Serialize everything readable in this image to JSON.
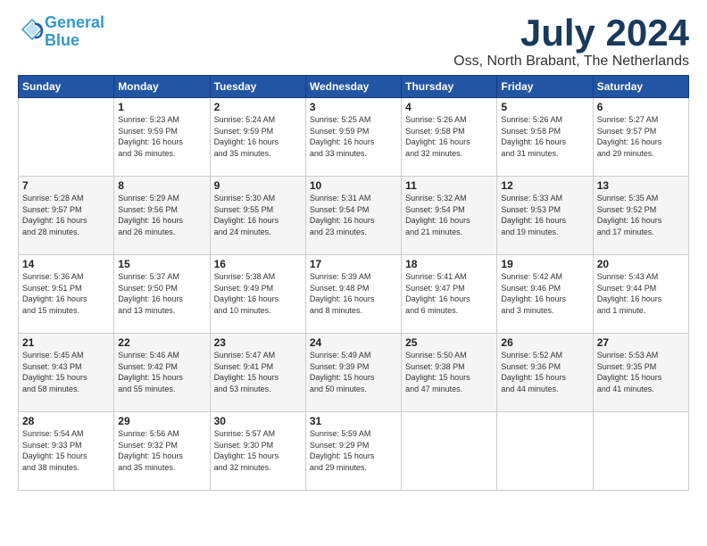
{
  "logo": {
    "line1": "General",
    "line2": "Blue"
  },
  "title": "July 2024",
  "location": "Oss, North Brabant, The Netherlands",
  "days_of_week": [
    "Sunday",
    "Monday",
    "Tuesday",
    "Wednesday",
    "Thursday",
    "Friday",
    "Saturday"
  ],
  "weeks": [
    [
      {
        "day": "",
        "info": ""
      },
      {
        "day": "1",
        "info": "Sunrise: 5:23 AM\nSunset: 9:59 PM\nDaylight: 16 hours\nand 36 minutes."
      },
      {
        "day": "2",
        "info": "Sunrise: 5:24 AM\nSunset: 9:59 PM\nDaylight: 16 hours\nand 35 minutes."
      },
      {
        "day": "3",
        "info": "Sunrise: 5:25 AM\nSunset: 9:59 PM\nDaylight: 16 hours\nand 33 minutes."
      },
      {
        "day": "4",
        "info": "Sunrise: 5:26 AM\nSunset: 9:58 PM\nDaylight: 16 hours\nand 32 minutes."
      },
      {
        "day": "5",
        "info": "Sunrise: 5:26 AM\nSunset: 9:58 PM\nDaylight: 16 hours\nand 31 minutes."
      },
      {
        "day": "6",
        "info": "Sunrise: 5:27 AM\nSunset: 9:57 PM\nDaylight: 16 hours\nand 29 minutes."
      }
    ],
    [
      {
        "day": "7",
        "info": "Sunrise: 5:28 AM\nSunset: 9:57 PM\nDaylight: 16 hours\nand 28 minutes."
      },
      {
        "day": "8",
        "info": "Sunrise: 5:29 AM\nSunset: 9:56 PM\nDaylight: 16 hours\nand 26 minutes."
      },
      {
        "day": "9",
        "info": "Sunrise: 5:30 AM\nSunset: 9:55 PM\nDaylight: 16 hours\nand 24 minutes."
      },
      {
        "day": "10",
        "info": "Sunrise: 5:31 AM\nSunset: 9:54 PM\nDaylight: 16 hours\nand 23 minutes."
      },
      {
        "day": "11",
        "info": "Sunrise: 5:32 AM\nSunset: 9:54 PM\nDaylight: 16 hours\nand 21 minutes."
      },
      {
        "day": "12",
        "info": "Sunrise: 5:33 AM\nSunset: 9:53 PM\nDaylight: 16 hours\nand 19 minutes."
      },
      {
        "day": "13",
        "info": "Sunrise: 5:35 AM\nSunset: 9:52 PM\nDaylight: 16 hours\nand 17 minutes."
      }
    ],
    [
      {
        "day": "14",
        "info": "Sunrise: 5:36 AM\nSunset: 9:51 PM\nDaylight: 16 hours\nand 15 minutes."
      },
      {
        "day": "15",
        "info": "Sunrise: 5:37 AM\nSunset: 9:50 PM\nDaylight: 16 hours\nand 13 minutes."
      },
      {
        "day": "16",
        "info": "Sunrise: 5:38 AM\nSunset: 9:49 PM\nDaylight: 16 hours\nand 10 minutes."
      },
      {
        "day": "17",
        "info": "Sunrise: 5:39 AM\nSunset: 9:48 PM\nDaylight: 16 hours\nand 8 minutes."
      },
      {
        "day": "18",
        "info": "Sunrise: 5:41 AM\nSunset: 9:47 PM\nDaylight: 16 hours\nand 6 minutes."
      },
      {
        "day": "19",
        "info": "Sunrise: 5:42 AM\nSunset: 9:46 PM\nDaylight: 16 hours\nand 3 minutes."
      },
      {
        "day": "20",
        "info": "Sunrise: 5:43 AM\nSunset: 9:44 PM\nDaylight: 16 hours\nand 1 minute."
      }
    ],
    [
      {
        "day": "21",
        "info": "Sunrise: 5:45 AM\nSunset: 9:43 PM\nDaylight: 15 hours\nand 58 minutes."
      },
      {
        "day": "22",
        "info": "Sunrise: 5:46 AM\nSunset: 9:42 PM\nDaylight: 15 hours\nand 55 minutes."
      },
      {
        "day": "23",
        "info": "Sunrise: 5:47 AM\nSunset: 9:41 PM\nDaylight: 15 hours\nand 53 minutes."
      },
      {
        "day": "24",
        "info": "Sunrise: 5:49 AM\nSunset: 9:39 PM\nDaylight: 15 hours\nand 50 minutes."
      },
      {
        "day": "25",
        "info": "Sunrise: 5:50 AM\nSunset: 9:38 PM\nDaylight: 15 hours\nand 47 minutes."
      },
      {
        "day": "26",
        "info": "Sunrise: 5:52 AM\nSunset: 9:36 PM\nDaylight: 15 hours\nand 44 minutes."
      },
      {
        "day": "27",
        "info": "Sunrise: 5:53 AM\nSunset: 9:35 PM\nDaylight: 15 hours\nand 41 minutes."
      }
    ],
    [
      {
        "day": "28",
        "info": "Sunrise: 5:54 AM\nSunset: 9:33 PM\nDaylight: 15 hours\nand 38 minutes."
      },
      {
        "day": "29",
        "info": "Sunrise: 5:56 AM\nSunset: 9:32 PM\nDaylight: 15 hours\nand 35 minutes."
      },
      {
        "day": "30",
        "info": "Sunrise: 5:57 AM\nSunset: 9:30 PM\nDaylight: 15 hours\nand 32 minutes."
      },
      {
        "day": "31",
        "info": "Sunrise: 5:59 AM\nSunset: 9:29 PM\nDaylight: 15 hours\nand 29 minutes."
      },
      {
        "day": "",
        "info": ""
      },
      {
        "day": "",
        "info": ""
      },
      {
        "day": "",
        "info": ""
      }
    ]
  ]
}
